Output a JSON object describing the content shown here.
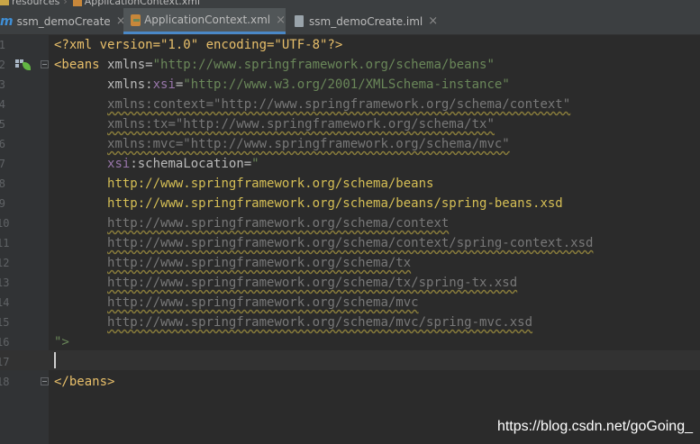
{
  "breadcrumb": {
    "items": [
      "resources",
      "ApplicationContext.xml"
    ]
  },
  "tabs": [
    {
      "label": "ssm_demoCreate",
      "icon": "maven-module-icon",
      "active": false
    },
    {
      "label": "ApplicationContext.xml",
      "icon": "xml-file-icon",
      "active": true
    },
    {
      "label": "ssm_demoCreate.iml",
      "icon": "iml-file-icon",
      "active": false
    }
  ],
  "tab_close_glyph": "×",
  "editor": {
    "line_numbers": [
      "1",
      "2",
      "3",
      "4",
      "5",
      "6",
      "7",
      "8",
      "9",
      "10",
      "11",
      "12",
      "13",
      "14",
      "15",
      "16",
      "17",
      "18"
    ],
    "lines": [
      [
        {
          "t": "<?xml version=\"1.0\" encoding=\"UTF-8\"?>",
          "k": "tag"
        }
      ],
      [
        {
          "t": "<beans ",
          "k": "tag"
        },
        {
          "t": "xmlns=",
          "k": "attr"
        },
        {
          "t": "\"http://www.springframework.org/schema/beans\"",
          "k": "val"
        }
      ],
      [
        {
          "t": "       ",
          "k": "plain"
        },
        {
          "t": "xmlns:",
          "k": "attr"
        },
        {
          "t": "xsi",
          "k": "ns"
        },
        {
          "t": "=",
          "k": "attr"
        },
        {
          "t": "\"http://www.w3.org/2001/XMLSchema-instance\"",
          "k": "val"
        }
      ],
      [
        {
          "t": "       ",
          "k": "plain"
        },
        {
          "t": "xmlns:context=\"http://www.springframework.org/schema/context\"",
          "k": "unused"
        }
      ],
      [
        {
          "t": "       ",
          "k": "plain"
        },
        {
          "t": "xmlns:tx=\"http://www.springframework.org/schema/tx\"",
          "k": "unused"
        }
      ],
      [
        {
          "t": "       ",
          "k": "plain"
        },
        {
          "t": "xmlns:mvc=\"http://www.springframework.org/schema/mvc\"",
          "k": "unused"
        }
      ],
      [
        {
          "t": "       ",
          "k": "plain"
        },
        {
          "t": "xsi",
          "k": "ns"
        },
        {
          "t": ":schemaLocation=",
          "k": "attr"
        },
        {
          "t": "\"",
          "k": "val"
        }
      ],
      [
        {
          "t": "       ",
          "k": "plain"
        },
        {
          "t": "http://www.springframework.org/schema/beans",
          "k": "url"
        }
      ],
      [
        {
          "t": "       ",
          "k": "plain"
        },
        {
          "t": "http://www.springframework.org/schema/beans/spring-beans.xsd",
          "k": "url"
        }
      ],
      [
        {
          "t": "       ",
          "k": "plain"
        },
        {
          "t": "http://www.springframework.org/schema/context",
          "k": "unused"
        }
      ],
      [
        {
          "t": "       ",
          "k": "plain"
        },
        {
          "t": "http://www.springframework.org/schema/context/spring-context.xsd",
          "k": "unused"
        }
      ],
      [
        {
          "t": "       ",
          "k": "plain"
        },
        {
          "t": "http://www.springframework.org/schema/tx",
          "k": "unused"
        }
      ],
      [
        {
          "t": "       ",
          "k": "plain"
        },
        {
          "t": "http://www.springframework.org/schema/tx/spring-tx.xsd",
          "k": "unused"
        }
      ],
      [
        {
          "t": "       ",
          "k": "plain"
        },
        {
          "t": "http://www.springframework.org/schema/mvc",
          "k": "unused"
        }
      ],
      [
        {
          "t": "       ",
          "k": "plain"
        },
        {
          "t": "http://www.springframework.org/schema/mvc/spring-mvc.xsd",
          "k": "unused"
        }
      ],
      [
        {
          "t": "\">",
          "k": "val"
        }
      ],
      [],
      [
        {
          "t": "</beans>",
          "k": "tag"
        }
      ]
    ]
  },
  "watermark": "https://blog.csdn.net/goGoing_",
  "colors": {
    "background": "#2b2b2b",
    "gutter": "#313335",
    "tab_bar": "#3c3f41",
    "active_tab": "#515658",
    "tag": "#e8bf6a",
    "string": "#6a8759",
    "namespace": "#9876aa",
    "unused": "#787878"
  }
}
